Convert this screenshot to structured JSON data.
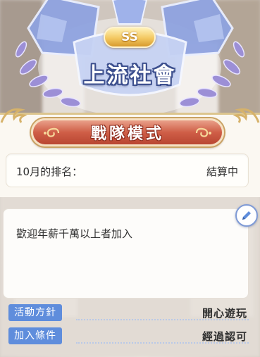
{
  "guild": {
    "rank": "SS",
    "name": "上流社會"
  },
  "mode": {
    "title": "戰隊模式"
  },
  "ranking": {
    "label": "10月的排名：",
    "status": "結算中"
  },
  "description": {
    "text": "歡迎年薪千萬以上者加入"
  },
  "fields": [
    {
      "label": "活動方針",
      "value": "開心遊玩"
    },
    {
      "label": "加入條件",
      "value": "經過認可"
    }
  ],
  "colors": {
    "banner_red": "#cf5e47",
    "tag_blue": "#5f8ddc",
    "gold": "#dcc58e"
  }
}
